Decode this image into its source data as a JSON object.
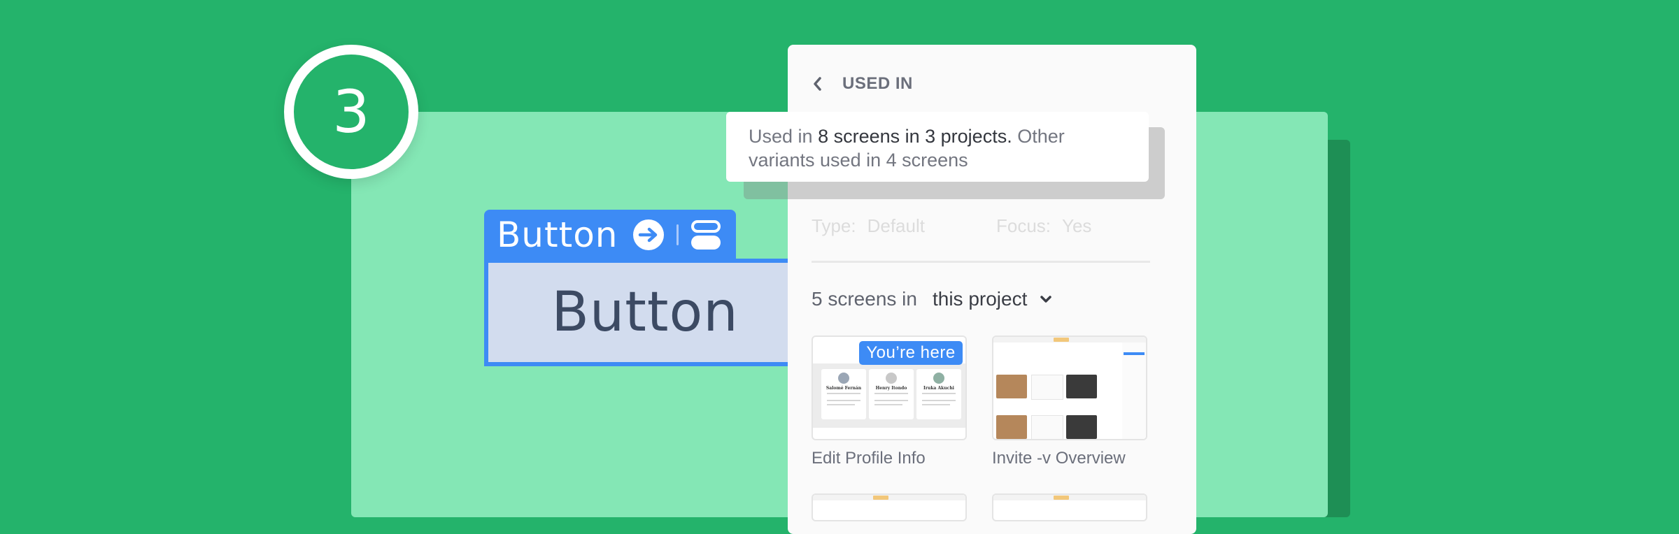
{
  "step": {
    "number": "3"
  },
  "component": {
    "label": "Button",
    "go_icon": "arrow-right-circle-icon",
    "variants_icon": "variants-icon",
    "preview_text": "Button"
  },
  "panel": {
    "back_icon": "chevron-left-icon",
    "title": "USED IN",
    "properties": [
      {
        "label": "Type:",
        "value": "Default"
      },
      {
        "label": "Focus:",
        "value": "Yes"
      }
    ],
    "scope": {
      "count_text": "5 screens in",
      "selected": "this project",
      "dropdown_icon": "chevron-down-icon"
    },
    "screens": [
      {
        "label": "Edit Profile Info",
        "badge": "You’re here",
        "cards": [
          "Salomé Fernán",
          "Henry Itondo",
          "Iruka Akuchi"
        ]
      },
      {
        "label": "Invite -v Overview"
      }
    ]
  },
  "tooltip": {
    "prefix": "Used in ",
    "highlight": "8 screens in 3 projects.",
    "suffix": " Other variants used in 4 screens"
  },
  "colors": {
    "background": "#24b36b",
    "frame": "#84e7b5",
    "frame_shadow": "#1e8f55",
    "accent_blue": "#3d8bf5",
    "selection_fill": "#d2dcee",
    "panel": "#fafafa"
  }
}
